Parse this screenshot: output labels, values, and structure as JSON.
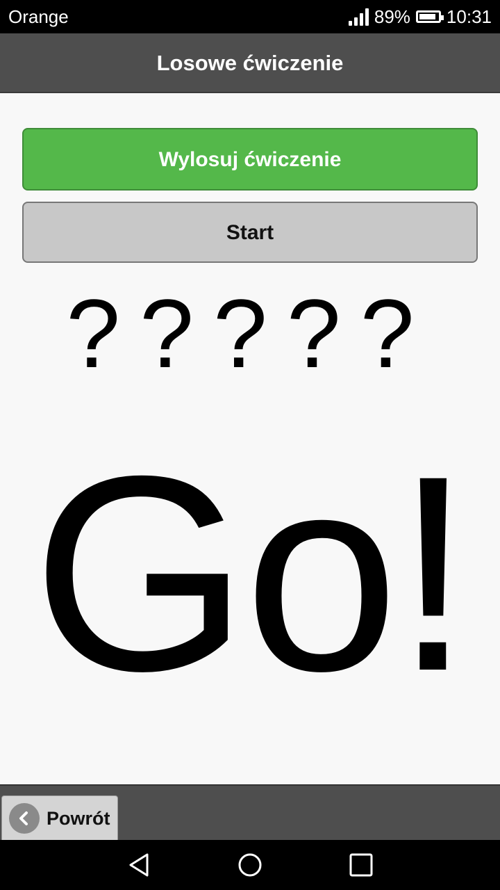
{
  "status_bar": {
    "carrier": "Orange",
    "battery_percent": "89%",
    "battery_level": 0.89,
    "time": "10:31",
    "icons": [
      "signal-icon",
      "battery-icon"
    ]
  },
  "header": {
    "title": "Losowe ćwiczenie"
  },
  "main": {
    "draw_button_label": "Wylosuj ćwiczenie",
    "start_button_label": "Start",
    "exercise_placeholder": "?????",
    "countdown_text": "Go!"
  },
  "footer": {
    "back_button_label": "Powrót",
    "back_icon": "chevron-left-icon"
  },
  "nav_bar": {
    "icons": [
      "back-triangle-icon",
      "home-circle-icon",
      "recents-square-icon"
    ]
  },
  "colors": {
    "draw_button": "#54b84a",
    "start_button": "#c8c8c8",
    "bars": "#4e4e4e",
    "background": "#f8f8f8"
  }
}
